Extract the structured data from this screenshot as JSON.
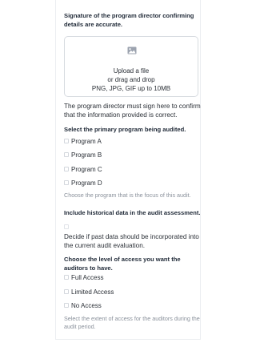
{
  "signature": {
    "label": "Signature of the program director confirming details are accurate.",
    "upload": {
      "title": "Upload a file",
      "subtitle": "or drag and drop",
      "hint": "PNG, JPG, GIF up to 10MB"
    },
    "help": "The program director must sign here to confirm that the information provided is correct."
  },
  "primary_program": {
    "label": "Select the primary program being audited.",
    "options": [
      {
        "label": "Program A"
      },
      {
        "label": "Program B"
      },
      {
        "label": "Program C"
      },
      {
        "label": "Program D"
      }
    ],
    "help": "Choose the program that is the focus of this audit."
  },
  "historical": {
    "label": "Include historical data in the audit assessment.",
    "help": "Decide if past data should be incorporated into the current audit evaluation."
  },
  "access": {
    "label": "Choose the level of access you want the auditors to have.",
    "options": [
      {
        "label": "Full Access"
      },
      {
        "label": "Limited Access"
      },
      {
        "label": "No Access"
      }
    ],
    "help": "Select the extent of access for the auditors during the audit period."
  },
  "icons": {
    "upload": "image-icon"
  }
}
